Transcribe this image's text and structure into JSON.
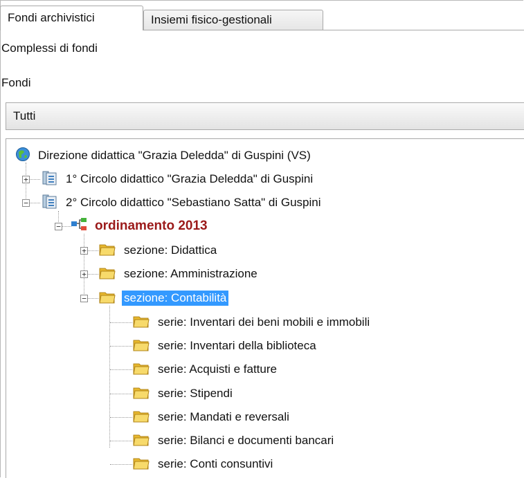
{
  "tabs": [
    {
      "label": "Fondi archivistici",
      "active": true
    },
    {
      "label": "Insiemi fisico-gestionali",
      "active": false
    }
  ],
  "filters": {
    "complessi_label": "Complessi di fondi",
    "fondi_label": "Fondi",
    "dropdown_value": "Tutti"
  },
  "tree": {
    "root": "Direzione didattica \"Grazia Deledda\" di Guspini (VS)",
    "circolo1": "1° Circolo didattico \"Grazia Deledda\" di Guspini",
    "circolo2": "2° Circolo didattico \"Sebastiano Satta\" di Guspini",
    "ordinamento": "ordinamento 2013",
    "sezioni": [
      {
        "label": "sezione: Didattica",
        "expanded": false
      },
      {
        "label": "sezione: Amministrazione",
        "expanded": false
      },
      {
        "label": "sezione: Contabilità",
        "expanded": true,
        "selected": true
      }
    ],
    "serie": [
      "serie: Inventari dei beni mobili e immobili",
      "serie: Inventari della biblioteca",
      "serie: Acquisti e fatture",
      "serie: Stipendi",
      "serie: Mandati e reversali",
      "serie: Bilanci e documenti bancari",
      "serie: Conti consuntivi"
    ]
  },
  "colors": {
    "selection": "#3399ff",
    "ordinamento_text": "#9b1a1a",
    "folder": "#f2c94c"
  }
}
